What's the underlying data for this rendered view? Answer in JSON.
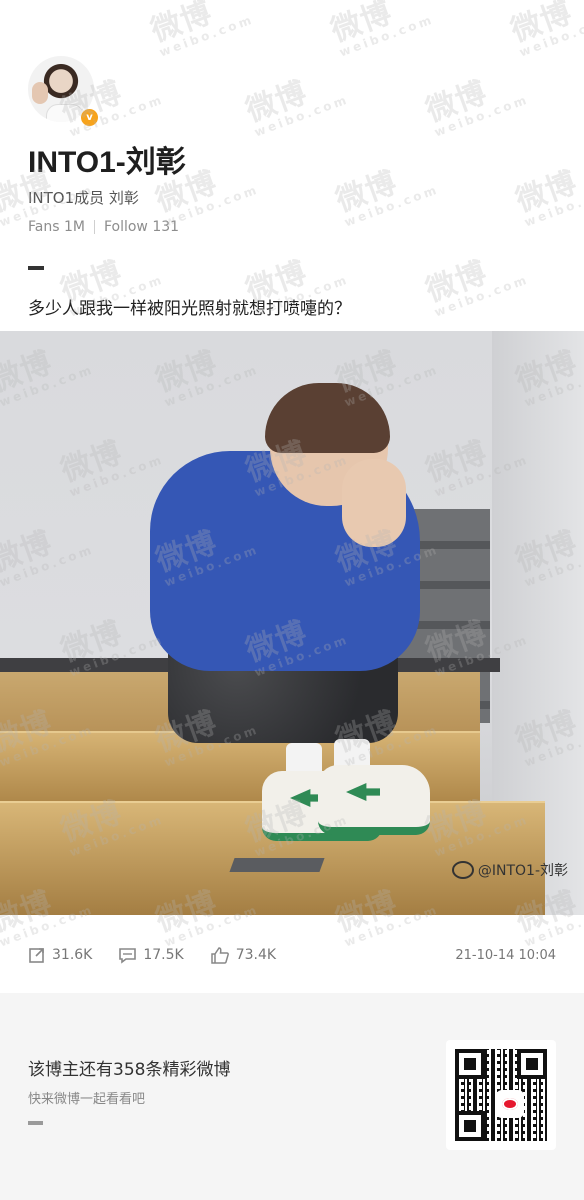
{
  "profile": {
    "nickname": "INTO1-刘彰",
    "subtitle": "INTO1成员 刘彰",
    "fans_label": "Fans",
    "fans_count": "1M",
    "follow_label": "Follow",
    "follow_count": "131",
    "verified_badge": "v"
  },
  "post": {
    "text": "多少人跟我一样被阳光照射就想打喷嚏的？",
    "image_watermark": "@INTO1-刘彰",
    "reposts": "31.6K",
    "comments": "17.5K",
    "likes": "73.4K",
    "timestamp": "21-10-14 10:04"
  },
  "footer": {
    "title": "该博主还有358条精彩微博",
    "subtitle": "快来微博一起看看吧"
  },
  "watermark": {
    "text": "微博",
    "domain": "weibo.com"
  },
  "colors": {
    "accent_badge": "#f7a31c",
    "weibo_red": "#e6162d",
    "footer_bg": "#f5f5f5"
  },
  "icons": [
    "repost-icon",
    "comment-icon",
    "like-icon",
    "weibo-logo-icon",
    "verified-badge-icon",
    "qr-code"
  ]
}
